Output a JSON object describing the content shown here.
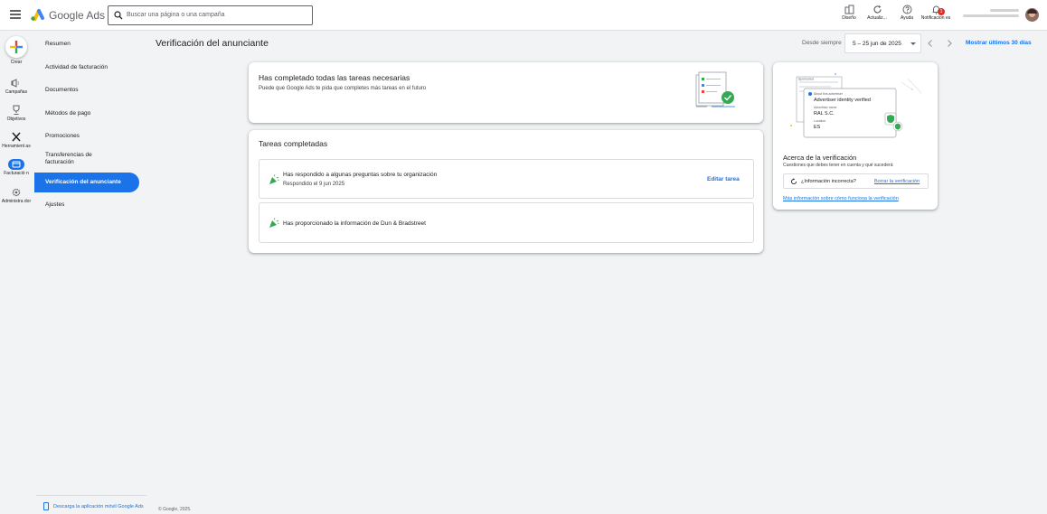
{
  "header": {
    "brand": "Google Ads",
    "search_placeholder": "Buscar una página o una campaña",
    "tools": [
      {
        "label": "Diseño",
        "icon": "appearance-icon"
      },
      {
        "label": "Actualiz...",
        "icon": "refresh-icon"
      },
      {
        "label": "Ayuda",
        "icon": "help-icon"
      },
      {
        "label": "Notificacion es",
        "icon": "bell-icon",
        "badge": "1"
      }
    ]
  },
  "rail": {
    "create_label": "Crear",
    "items": [
      {
        "label": "Campañas",
        "icon": "megaphone-icon"
      },
      {
        "label": "Objetivos",
        "icon": "trophy-icon"
      },
      {
        "label": "Herramient as",
        "icon": "tools-icon"
      },
      {
        "label": "Facturació n",
        "icon": "billing-icon",
        "active": true
      },
      {
        "label": "Administra dor",
        "icon": "admin-gear-icon"
      }
    ]
  },
  "subnav": {
    "items": [
      {
        "label": "Resumen"
      },
      {
        "label": "Actividad de facturación"
      },
      {
        "label": "Documentos"
      },
      {
        "label": "Métodos de pago"
      },
      {
        "label": "Promociones"
      },
      {
        "label": "Transferencias de facturación"
      },
      {
        "label": "Verificación del anunciante",
        "active": true
      },
      {
        "label": "Ajustes"
      }
    ],
    "mobile_app_label": "Descarga la aplicación móvil Google Ads",
    "copyright": "© Google, 2025."
  },
  "main": {
    "title": "Verificación del anunciante",
    "date_label": "Desde siempre",
    "date_range": "5 – 25 jun de 2025",
    "show_last_label": "Mostrar últimos 30 días"
  },
  "summary_card": {
    "title": "Has completado todas las tareas necesarias",
    "subtitle": "Puede que Google Ads te pida que completes más tareas en el futuro"
  },
  "tasks_card": {
    "title": "Tareas completadas",
    "tasks": [
      {
        "title": "Has respondido a algunas preguntas sobre tu organización",
        "subtitle": "Respondido el 9 jun 2025",
        "action": "Editar tarea"
      },
      {
        "title": "Has proporcionado la información de Dun & Bradstreet"
      }
    ]
  },
  "about_card": {
    "illustration": {
      "header_text": "Sponsored",
      "badge_line": "About this advertiser",
      "verified_text": "Advertiser identity verified",
      "name_label": "Advertiser name",
      "name_value": "RAL S.C.",
      "location_label": "Location",
      "location_value": "ES"
    },
    "title": "Acerca de la verificación",
    "subtitle": "Cuestiones que debes tener en cuenta y qué sucederá",
    "question": "¿Información incorrecta?",
    "delete_link": "Borrar la verificación",
    "more_link": "Más información sobre cómo funciona la verificación"
  },
  "colors": {
    "accent": "#1a73e8",
    "success": "#34a853",
    "notification": "#d93025"
  }
}
